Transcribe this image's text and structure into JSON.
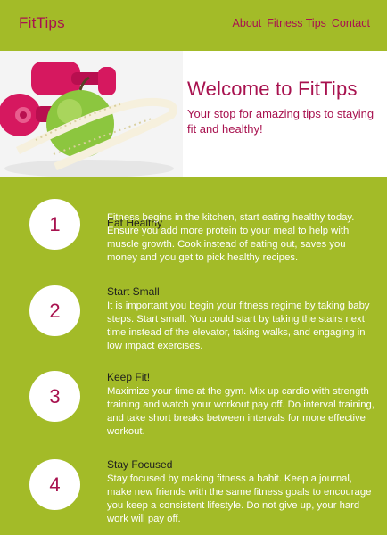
{
  "brand": {
    "logo_prefix": "Fi",
    "logo_highlight": "t",
    "logo_suffix": "Tips"
  },
  "nav": {
    "items": [
      "About",
      "Fitness Tips",
      "Contact"
    ]
  },
  "hero": {
    "title": "Welcome to FitTips",
    "subtitle": "Your stop for amazing tips to staying fit and healthy!",
    "image": "dumbbells-apple-measuring-tape"
  },
  "tips": [
    {
      "number": "1",
      "title": "Eat Healthy",
      "body": "Fitness begins in the kitchen, start eating healthy today. Ensure you add more protein to your meal to help with muscle growth. Cook instead of eating out, saves you money and you get to pick healthy recipes."
    },
    {
      "number": "2",
      "title": "Start Small",
      "body": "It is important you begin your fitness regime by taking baby steps. Start small. You could start by taking the stairs next time instead of the elevator, taking walks, and engaging in low impact exercises."
    },
    {
      "number": "3",
      "title": "Keep Fit!",
      "body": "Maximize your time at the gym. Mix up cardio with strength training and watch your workout pay off. Do interval training, and take short breaks between intervals for more effective workout."
    },
    {
      "number": "4",
      "title": "Stay Focused",
      "body": "Stay focused by making fitness a habit. Keep a journal, make new friends with the same fitness goals to encourage you keep a consistent lifestyle. Do not give up, your hard work will pay off."
    }
  ],
  "colors": {
    "background": "#a3bb28",
    "accent": "#a8124f",
    "circle": "#ffffff"
  }
}
